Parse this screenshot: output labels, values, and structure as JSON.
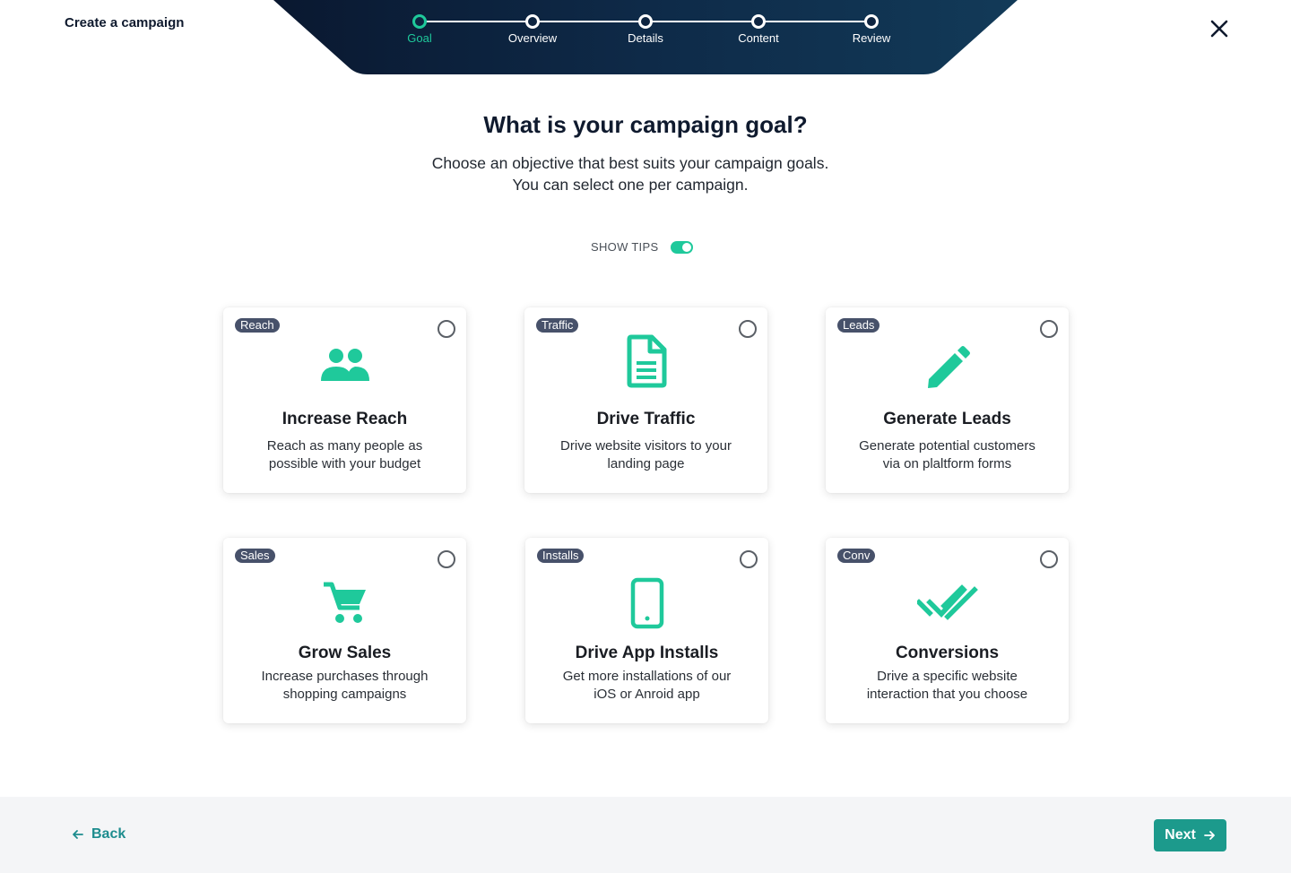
{
  "header": {
    "title": "Create a campaign"
  },
  "stepper": {
    "steps": [
      {
        "label": "Goal",
        "active": true
      },
      {
        "label": "Overview",
        "active": false
      },
      {
        "label": "Details",
        "active": false
      },
      {
        "label": "Content",
        "active": false
      },
      {
        "label": "Review",
        "active": false
      }
    ]
  },
  "main": {
    "title": "What is your campaign goal?",
    "subtitle": "Choose an objective that best suits your campaign goals. You can select one per campaign.",
    "tips_label": "SHOW TIPS",
    "tips_enabled": true
  },
  "cards": [
    {
      "tag": "Reach",
      "title": "Increase Reach",
      "description": "Reach as many people as possible with your budget",
      "icon": "people-icon",
      "selected": false
    },
    {
      "tag": "Traffic",
      "title": "Drive Traffic",
      "description": "Drive website visitors to your landing page",
      "icon": "document-icon",
      "selected": false
    },
    {
      "tag": "Leads",
      "title": "Generate Leads",
      "description": "Generate potential customers via on plaltform forms",
      "icon": "pencil-icon",
      "selected": false
    },
    {
      "tag": "Sales",
      "title": "Grow Sales",
      "description": "Increase purchases through shopping campaigns",
      "icon": "cart-icon",
      "selected": false
    },
    {
      "tag": "Installs",
      "title": "Drive App Installs",
      "description": "Get more installations of our iOS or Anroid app",
      "icon": "phone-icon",
      "selected": false
    },
    {
      "tag": "Conv",
      "title": "Conversions",
      "description": "Drive a specific website interaction that you choose",
      "icon": "double-check-icon",
      "selected": false
    }
  ],
  "footer": {
    "back_label": "Back",
    "next_label": "Next"
  },
  "colors": {
    "accent": "#1fc99b",
    "navy": "#0d2440",
    "button": "#1c9a8c",
    "back_link": "#1d8c8e",
    "tag_bg": "#47516a"
  }
}
